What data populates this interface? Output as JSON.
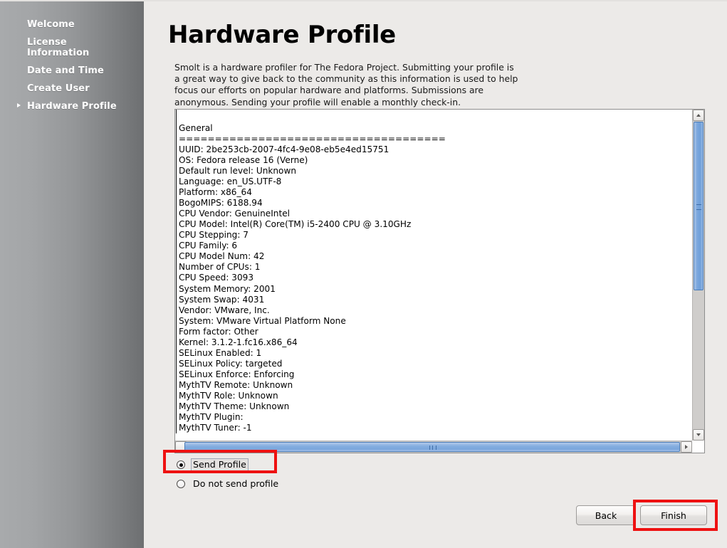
{
  "sidebar": {
    "items": [
      {
        "label": "Welcome",
        "active": false
      },
      {
        "label": "License\nInformation",
        "active": false
      },
      {
        "label": "Date and Time",
        "active": false
      },
      {
        "label": "Create User",
        "active": false
      },
      {
        "label": "Hardware Profile",
        "active": true
      }
    ]
  },
  "main": {
    "title": "Hardware Profile",
    "intro": "Smolt is a hardware profiler for The Fedora Project.  Submitting your profile is\na great way to give back to the community as this information is used to help\nfocus our efforts on popular hardware and platforms.  Submissions are\nanonymous.  Sending your profile will enable a monthly check-in."
  },
  "profile": {
    "text": "\nGeneral\n=====================================\nUUID: 2be253cb-2007-4fc4-9e08-eb5e4ed15751\nOS: Fedora release 16 (Verne)\nDefault run level: Unknown\nLanguage: en_US.UTF-8\nPlatform: x86_64\nBogoMIPS: 6188.94\nCPU Vendor: GenuineIntel\nCPU Model: Intel(R) Core(TM) i5-2400 CPU @ 3.10GHz\nCPU Stepping: 7\nCPU Family: 6\nCPU Model Num: 42\nNumber of CPUs: 1\nCPU Speed: 3093\nSystem Memory: 2001\nSystem Swap: 4031\nVendor: VMware, Inc.\nSystem: VMware Virtual Platform None\nForm factor: Other\nKernel: 3.1.2-1.fc16.x86_64\nSELinux Enabled: 1\nSELinux Policy: targeted\nSELinux Enforce: Enforcing\nMythTV Remote: Unknown\nMythTV Role: Unknown\nMythTV Theme: Unknown\nMythTV Plugin:\nMythTV Tuner: -1"
  },
  "options": {
    "send_label": "Send Profile",
    "dont_send_label": "Do not send profile",
    "selected": "send"
  },
  "buttons": {
    "back": "Back",
    "finish": "Finish"
  },
  "colors": {
    "annotation": "#ee1111",
    "scrollbar_thumb": "#7ba7dd",
    "background": "#eceae8"
  }
}
